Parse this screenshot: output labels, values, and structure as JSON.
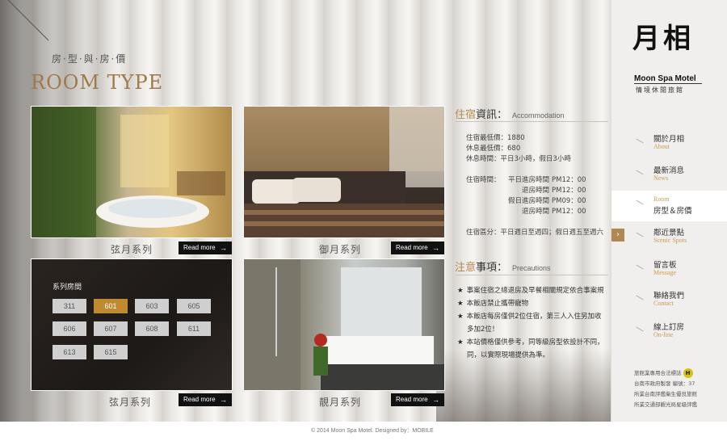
{
  "header": {
    "subtitle_zh": "房·型·與·房·價",
    "title_en": "ROOM TYPE"
  },
  "rooms": [
    {
      "name": "弦月系列",
      "read_more": "Read more"
    },
    {
      "name": "御月系列",
      "read_more": "Read more"
    },
    {
      "name": "弦月系列",
      "read_more": "Read more"
    },
    {
      "name": "靚月系列",
      "read_more": "Read more"
    }
  ],
  "room_numbers": {
    "label": "系列房間",
    "numbers": [
      "311",
      "601",
      "603",
      "605",
      "606",
      "607",
      "608",
      "611",
      "613",
      "615"
    ],
    "selected": "601"
  },
  "accommodation": {
    "title_accent": "住宿",
    "title_rest": "資訊：",
    "title_en": "Accommodation",
    "lines": [
      "住宿最低價：1880",
      "休息最低價：680",
      "休息時間：平日3小時，假日3小時"
    ],
    "times_label": "住宿時間：",
    "times": [
      {
        "k": "平日進房時間",
        "v": "PM12：00"
      },
      {
        "k": "退房時間",
        "v": "PM12：00"
      },
      {
        "k": "假日進房時間",
        "v": "PM09：00"
      },
      {
        "k": "退房時間",
        "v": "PM12：00"
      }
    ],
    "period": "住宿區分：平日週日至週四；假日週五至週六"
  },
  "notice": {
    "title_accent": "注意",
    "title_rest": "事項：",
    "title_en": "Precautions",
    "items": [
      "事案住宿之總退房及早餐相關規定依合事案規",
      "本飯店禁止攜帶寵物",
      "本飯店每房僅供2位住宿，第三人入住另加收",
      "多加2位！",
      "本站價格僅供參考，同等級房型依設計不同，",
      "同，以實際現場提供為準。"
    ]
  },
  "sidebar": {
    "logo_glyph": "月相",
    "logo_en": "Moon Spa Motel",
    "logo_zh": "情境休閒旅館",
    "nav": [
      {
        "zh": "關於月相",
        "en": "About"
      },
      {
        "zh": "最新消息",
        "en": "News"
      },
      {
        "zh": "房型＆房價",
        "en": "Room"
      },
      {
        "zh": "鄰近景點",
        "en": "Scenic Spots"
      },
      {
        "zh": "留言板",
        "en": "Message"
      },
      {
        "zh": "聯絡我們",
        "en": "Contact"
      },
      {
        "zh": "線上訂房",
        "en": "On-line"
      }
    ],
    "active_index": 2,
    "footer_lines": [
      "旅館業專用合法標誌",
      "台南市政府製發 編號：37",
      "所業台南評鑑衛生優良旅館",
      "所業交通部觀光局星級評鑑"
    ]
  },
  "footer": {
    "text": "© 2014 Moon Spa Motel.   Designed by：MOBILE"
  }
}
